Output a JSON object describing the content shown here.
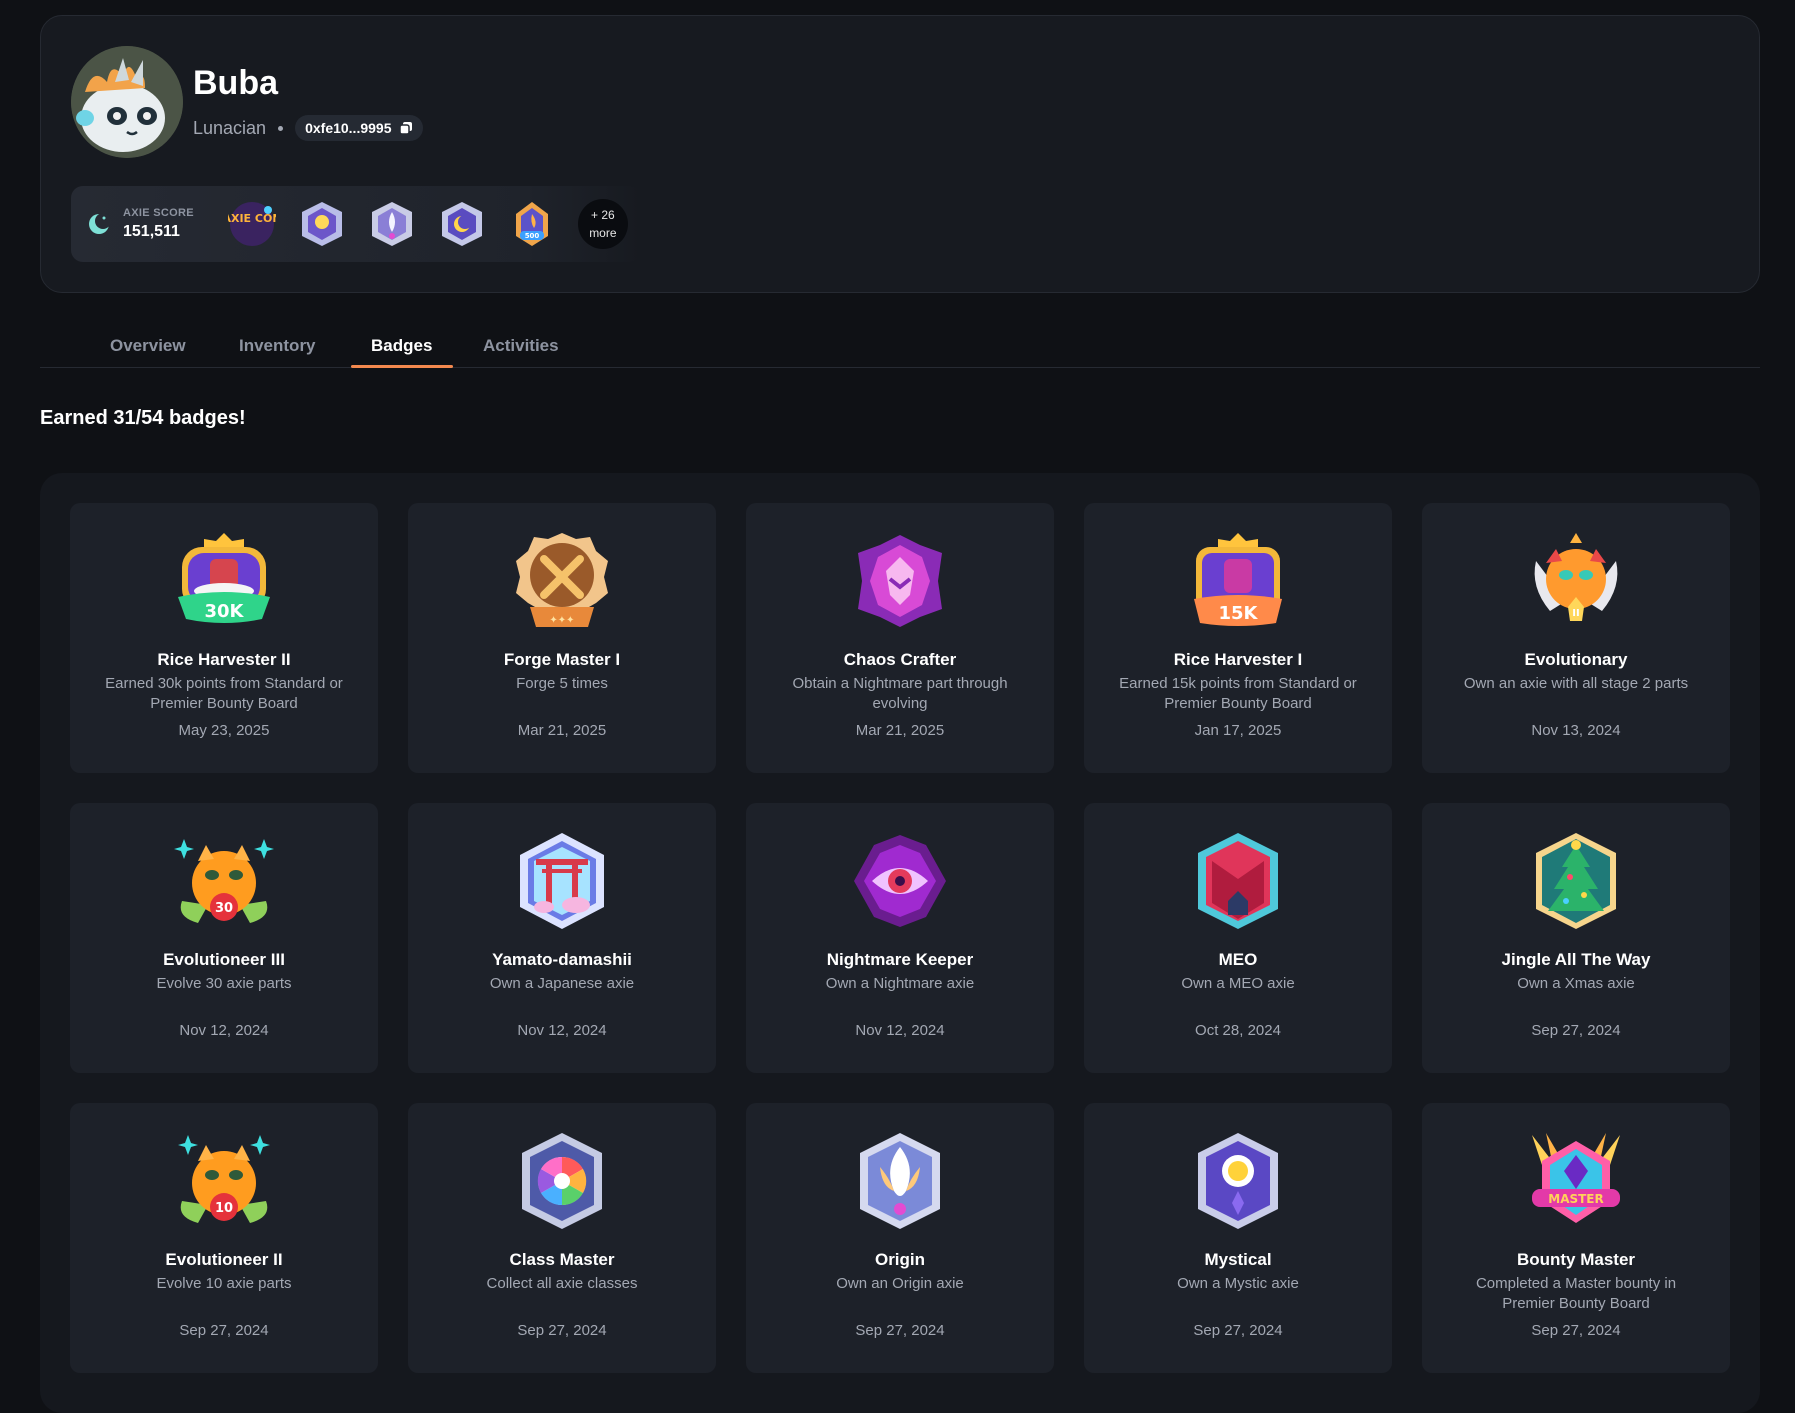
{
  "profile": {
    "name": "Buba",
    "role": "Lunacian",
    "address": "0xfe10...9995",
    "score_label": "AXIE SCORE",
    "score_value": "151,511",
    "more_line1": "+ 26",
    "more_line2": "more",
    "mini_badges": [
      "axiecon-badge-icon",
      "mystic-shield-icon",
      "origin-shield-icon",
      "moon-shield-icon",
      "500-flame-icon"
    ]
  },
  "tabs": [
    "Overview",
    "Inventory",
    "Badges",
    "Activities"
  ],
  "active_tab": "Badges",
  "earned_text": "Earned 31/54 badges!",
  "badges": [
    {
      "title": "Rice Harvester II",
      "desc": "Earned 30k points from Standard or Premier Bounty Board",
      "date": "May 23, 2025",
      "icon": "rice-harvester-30k-icon"
    },
    {
      "title": "Forge Master I",
      "desc": "Forge 5 times",
      "date": "Mar 21, 2025",
      "icon": "forge-hammers-icon"
    },
    {
      "title": "Chaos Crafter",
      "desc": "Obtain a Nightmare part through evolving",
      "date": "Mar 21, 2025",
      "icon": "chaos-crafter-icon"
    },
    {
      "title": "Rice Harvester I",
      "desc": "Earned 15k points from Standard or Premier Bounty Board",
      "date": "Jan 17, 2025",
      "icon": "rice-harvester-15k-icon"
    },
    {
      "title": "Evolutionary",
      "desc": "Own an axie with all stage 2 parts",
      "date": "Nov 13, 2024",
      "icon": "evolutionary-icon"
    },
    {
      "title": "Evolutioneer III",
      "desc": "Evolve 30 axie parts",
      "date": "Nov 12, 2024",
      "icon": "evolutioneer-30-icon"
    },
    {
      "title": "Yamato-damashii",
      "desc": "Own a Japanese axie",
      "date": "Nov 12, 2024",
      "icon": "torii-gate-icon"
    },
    {
      "title": "Nightmare Keeper",
      "desc": "Own a Nightmare axie",
      "date": "Nov 12, 2024",
      "icon": "nightmare-eye-icon"
    },
    {
      "title": "MEO",
      "desc": "Own a MEO axie",
      "date": "Oct 28, 2024",
      "icon": "meo-shield-icon"
    },
    {
      "title": "Jingle All The Way",
      "desc": "Own a Xmas axie",
      "date": "Sep 27, 2024",
      "icon": "xmas-tree-icon"
    },
    {
      "title": "Evolutioneer II",
      "desc": "Evolve 10 axie parts",
      "date": "Sep 27, 2024",
      "icon": "evolutioneer-10-icon"
    },
    {
      "title": "Class Master",
      "desc": "Collect all axie classes",
      "date": "Sep 27, 2024",
      "icon": "class-master-icon"
    },
    {
      "title": "Origin",
      "desc": "Own an Origin axie",
      "date": "Sep 27, 2024",
      "icon": "origin-icon"
    },
    {
      "title": "Mystical",
      "desc": "Own a Mystic axie",
      "date": "Sep 27, 2024",
      "icon": "mystical-icon"
    },
    {
      "title": "Bounty Master",
      "desc": "Completed a Master bounty in Premier Bounty Board",
      "date": "Sep 27, 2024",
      "icon": "bounty-master-icon"
    }
  ],
  "badge_texts": {
    "b0": "30K",
    "b3": "15K",
    "b5": "30",
    "b10": "10",
    "b14": "MASTER",
    "mini": "500",
    "axiecon": "AXIE CON"
  }
}
